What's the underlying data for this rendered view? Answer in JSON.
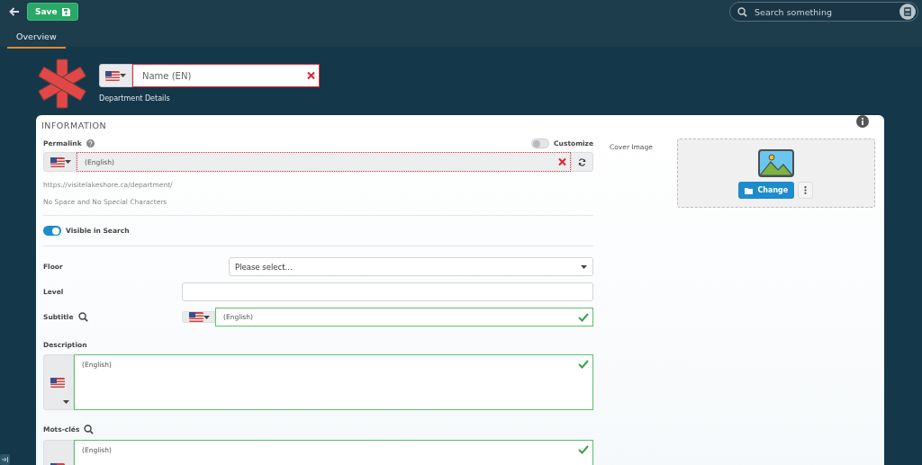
{
  "topbar": {
    "save_button": "Save",
    "search": {
      "placeholder": "Search something"
    }
  },
  "tabs": [
    {
      "label": "Overview",
      "selected": true
    }
  ],
  "header": {
    "name_field": {
      "placeholder": "Name (EN)",
      "valid": false
    },
    "subtitle": "Department Details"
  },
  "section": {
    "title": "INFORMATION",
    "permalink": {
      "label": "Permalink",
      "customize": {
        "label": "Customize",
        "on": false
      },
      "field": {
        "placeholder": "(English)",
        "valid": false
      },
      "url": "https://visitelakeshore.ca/department/",
      "hint": "No Space and No Special Characters"
    },
    "visible_in_search": {
      "label": "Visible in Search",
      "on": true
    },
    "fields": [
      {
        "kind": "select",
        "label": "Floor",
        "placeholder": "Please select..."
      },
      {
        "kind": "text",
        "label": "Level"
      },
      {
        "kind": "translated",
        "label": "Subtitle",
        "search": true,
        "placeholder": "(English)",
        "valid": true
      },
      {
        "kind": "textarea",
        "label": "Description",
        "search": false,
        "placeholder": "(English)",
        "valid": true
      },
      {
        "kind": "textarea",
        "label": "Mots-clés",
        "search": true,
        "placeholder": "(English)",
        "valid": true
      }
    ]
  },
  "cover_image": {
    "label": "Cover Image",
    "change_button": "Change"
  }
}
